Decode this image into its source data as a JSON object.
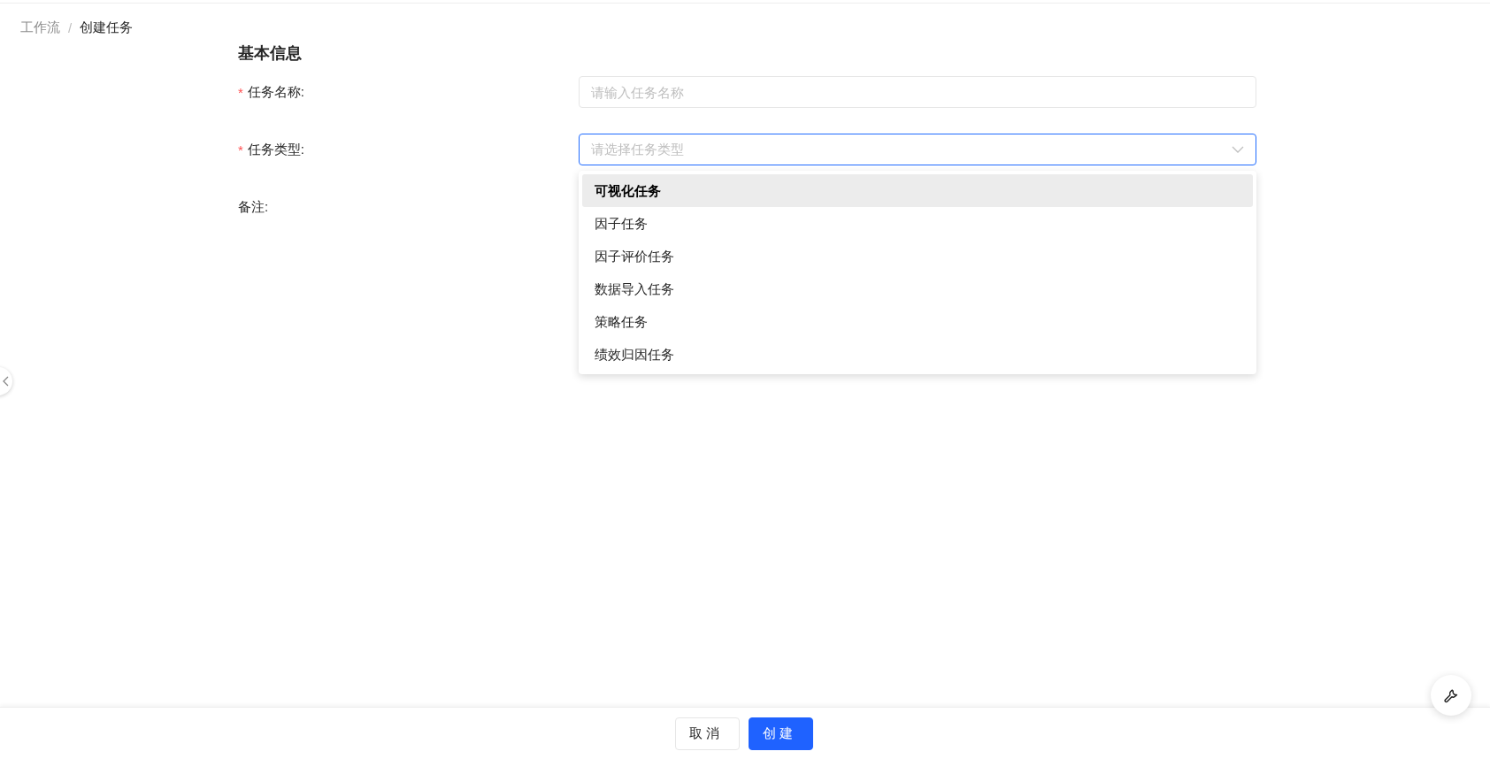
{
  "breadcrumb": [
    {
      "label": "工作流",
      "current": false
    },
    {
      "label": "创建任务",
      "current": true
    }
  ],
  "breadcrumb_separator": "/",
  "section_title": "基本信息",
  "required_mark": "*",
  "fields": [
    {
      "label": "任务名称:",
      "required": true,
      "kind": "input",
      "placeholder": "请输入任务名称",
      "focused": false
    },
    {
      "label": "任务类型:",
      "required": true,
      "kind": "select",
      "placeholder": "请选择任务类型",
      "focused": true
    },
    {
      "label": "备注:",
      "required": false,
      "kind": "textarea"
    }
  ],
  "dropdown": {
    "options": [
      {
        "label": "可视化任务",
        "selected": true
      },
      {
        "label": "因子任务",
        "selected": false
      },
      {
        "label": "因子评价任务",
        "selected": false
      },
      {
        "label": "数据导入任务",
        "selected": false
      },
      {
        "label": "策略任务",
        "selected": false
      },
      {
        "label": "绩效归因任务",
        "selected": false
      }
    ]
  },
  "buttons": [
    {
      "label": "取消",
      "kind": "default"
    },
    {
      "label": "创建",
      "kind": "primary"
    }
  ]
}
